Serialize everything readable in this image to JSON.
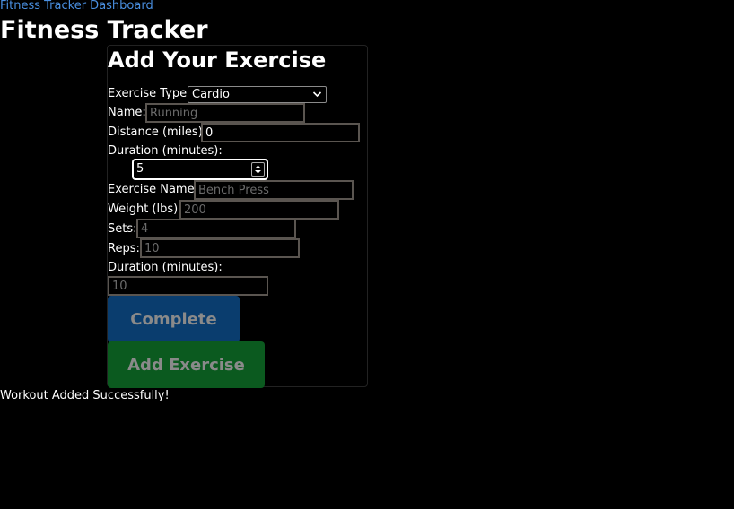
{
  "header": {
    "link_text": "Fitness Tracker Dashboard",
    "title": "Fitness Tracker"
  },
  "form": {
    "title": "Add Your Exercise",
    "exercise_type": {
      "label": "Exercise Type:",
      "value": "Cardio"
    },
    "cardio": {
      "name": {
        "label": "Name:",
        "value": "",
        "placeholder": "Running"
      },
      "distance": {
        "label": "Distance (miles):",
        "value": "0",
        "placeholder": ""
      },
      "duration": {
        "label": "Duration (minutes):",
        "value": "5",
        "placeholder": ""
      }
    },
    "strength": {
      "exercise_name": {
        "label": "Exercise Name:",
        "value": "",
        "placeholder": "Bench Press"
      },
      "weight": {
        "label": "Weight (lbs):",
        "value": "",
        "placeholder": "200"
      },
      "sets": {
        "label": "Sets:",
        "value": "",
        "placeholder": "4"
      },
      "reps": {
        "label": "Reps:",
        "value": "",
        "placeholder": "10"
      },
      "duration": {
        "label": "Duration (minutes):",
        "value": "",
        "placeholder": "10"
      }
    },
    "buttons": {
      "complete": "Complete",
      "add_exercise": "Add Exercise"
    }
  },
  "status_message": "Workout Added Successfully!",
  "colors": {
    "background": "#000000",
    "link": "#4a90e2",
    "complete_button": "#0a3d6e",
    "add_button": "#0b5a1f"
  },
  "icons": {
    "select_arrow": "chevron-down-icon",
    "number_spinner": "spinner-icon"
  }
}
